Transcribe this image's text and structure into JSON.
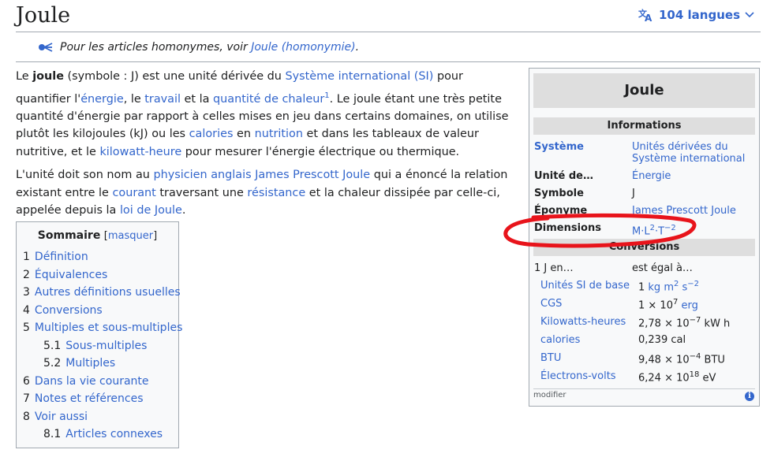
{
  "header": {
    "title": "Joule",
    "languages_label": "104 langues"
  },
  "hatnote": {
    "prefix": "Pour les articles homonymes, voir ",
    "link": "Joule (homonymie)",
    "suffix": "."
  },
  "intro": {
    "p1": {
      "t1": "Le ",
      "bold": "joule",
      "t2": " (symbole : J) est une unité dérivée du ",
      "l1": "Système international (SI)",
      "t3": " pour quantifier l'",
      "l2": "énergie",
      "t4": ", le ",
      "l3": "travail",
      "t5": " et la ",
      "l4": "quantité de chaleur",
      "ref": "1",
      "t6": ". Le joule étant une très petite quantité d'énergie par rapport à celles mises en jeu dans certains domaines, on utilise plutôt les kilojoules (kJ) ou les ",
      "l5": "calories",
      "t7": " en ",
      "l6": "nutrition",
      "t8": " et dans les tableaux de valeur nutritive, et le ",
      "l7": "kilowatt-heure",
      "t9": " pour mesurer l'énergie électrique ou thermique."
    },
    "p2": {
      "t1": "L'unité doit son nom au ",
      "l1": "physicien anglais",
      "t2": " ",
      "l2": "James Prescott Joule",
      "t3": " qui a énoncé la relation existant entre le ",
      "l3": "courant",
      "t4": " traversant une ",
      "l4": "résistance",
      "t5": " et la chaleur dissipée par celle-ci, appelée depuis la ",
      "l5": "loi de Joule",
      "t6": "."
    }
  },
  "toc": {
    "title": "Sommaire",
    "toggle": "masquer",
    "items": [
      {
        "num": "1",
        "label": "Définition"
      },
      {
        "num": "2",
        "label": "Équivalences"
      },
      {
        "num": "3",
        "label": "Autres définitions usuelles"
      },
      {
        "num": "4",
        "label": "Conversions"
      },
      {
        "num": "5",
        "label": "Multiples et sous-multiples"
      },
      {
        "num": "5.1",
        "label": "Sous-multiples"
      },
      {
        "num": "5.2",
        "label": "Multiples"
      },
      {
        "num": "6",
        "label": "Dans la vie courante"
      },
      {
        "num": "7",
        "label": "Notes et références"
      },
      {
        "num": "8",
        "label": "Voir aussi"
      },
      {
        "num": "8.1",
        "label": "Articles connexes"
      }
    ]
  },
  "infobox": {
    "title": "Joule",
    "section_info": "Informations",
    "systeme_k": "Système",
    "systeme_v": "Unités dérivées du Système international",
    "unite_k": "Unité de…",
    "unite_v": "Énergie",
    "symbole_k": "Symbole",
    "symbole_v": "J",
    "eponyme_k": "Éponyme",
    "eponyme_v": "James Prescott Joule",
    "dimensions_k": "Dimensions",
    "dim_m": "M·L",
    "dim_e1": "2",
    "dim_t": "·T",
    "dim_e2": "−2",
    "section_conv": "Conversions",
    "conv_head_k": "1 J en…",
    "conv_head_v": "est égal à…",
    "conversions": [
      {
        "unit": "Unités SI de base",
        "v1": "1 ",
        "v1link": "kg m",
        "sup1": "2",
        "v2": " ",
        "v2link": "s",
        "sup2": "−2"
      },
      {
        "unit": "CGS",
        "v1": "1 × 10",
        "sup1": "7",
        "v2": " ",
        "v2link": "erg"
      },
      {
        "unit": "Kilowatts-heures",
        "v1": "2,78 × 10",
        "sup1": "−7",
        "v2": " kW h"
      },
      {
        "unit": "calories",
        "v1": "0,239 cal"
      },
      {
        "unit": "BTU",
        "v1": "9,48 × 10",
        "sup1": "−4",
        "v2": " BTU"
      },
      {
        "unit": "Électrons-volts",
        "v1": "6,24 × 10",
        "sup1": "18",
        "v2": " eV"
      }
    ],
    "footer": "modifier"
  },
  "colors": {
    "link": "#3366cc",
    "annotation": "#e8141b",
    "infobox_header": "#dedede"
  }
}
